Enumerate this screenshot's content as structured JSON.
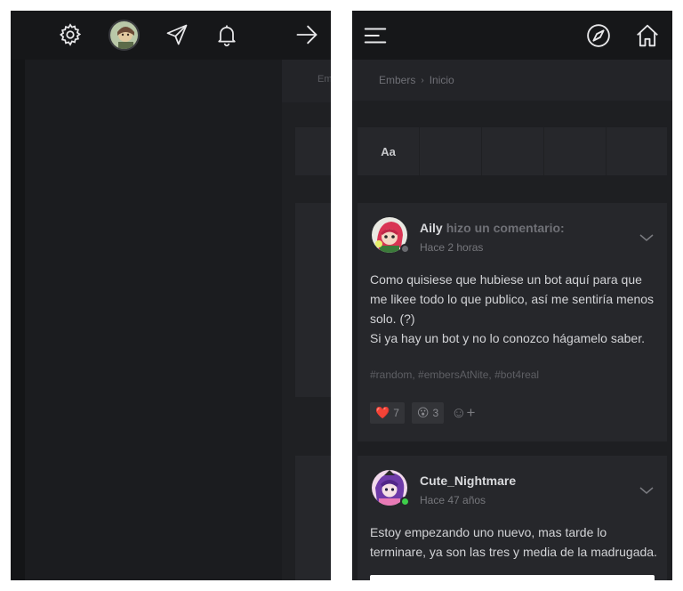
{
  "left_pane": {
    "topbar": {
      "icons": [
        "gear-icon",
        "avatar",
        "send-icon",
        "bell-icon",
        "arrow-right-icon"
      ]
    },
    "peek_breadcrumb": "Emb"
  },
  "right_pane": {
    "topbar": {
      "icons": [
        "menu-icon",
        "compass-icon",
        "home-icon"
      ]
    },
    "breadcrumb": {
      "items": [
        "Embers",
        "Inicio"
      ],
      "separator": "›"
    },
    "toolbar": {
      "first_label": "Aa"
    },
    "posts": [
      {
        "author": "Aily",
        "action": "hizo un comentario:",
        "time": "Hace 2 horas",
        "status": "offline",
        "lines": [
          "Como quisiese que hubiese un bot aquí para que",
          "me likee todo lo que publico, así me sentiría menos",
          "solo. (?)",
          "Si ya hay un bot y no lo conozco hágamelo saber."
        ],
        "tags": "#random, #embersAtNite, #bot4real",
        "reactions": [
          {
            "emoji": "❤️",
            "count": "7"
          },
          {
            "emoji": "😮",
            "count": "3"
          }
        ],
        "add_reaction": "☺+"
      },
      {
        "author": "Cute_Nightmare",
        "action": "",
        "time": "Hace 47 años",
        "status": "online",
        "lines": [
          "Estoy empezando uno nuevo, mas tarde lo",
          "terminare, ya son las tres y media de la madrugada."
        ]
      }
    ]
  },
  "colors": {
    "background": "#1e1f22",
    "topbar": "#161719",
    "card": "#26272b",
    "text": "#d2d3d6",
    "muted": "#6f7076",
    "online": "#3ecf4a",
    "offline": "#6a6b70",
    "heart": "#e0474c"
  }
}
